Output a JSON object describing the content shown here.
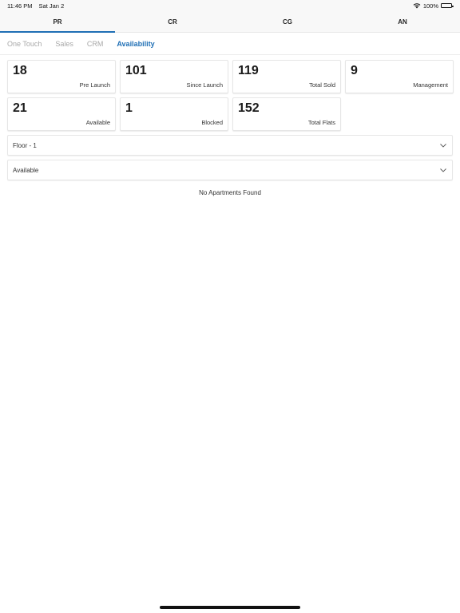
{
  "status_bar": {
    "time": "11:46 PM",
    "date": "Sat Jan 2",
    "battery": "100%"
  },
  "top_tabs": [
    {
      "label": "PR",
      "active": true
    },
    {
      "label": "CR",
      "active": false
    },
    {
      "label": "CG",
      "active": false
    },
    {
      "label": "AN",
      "active": false
    }
  ],
  "sub_tabs": [
    {
      "label": "One Touch",
      "active": false
    },
    {
      "label": "Sales",
      "active": false
    },
    {
      "label": "CRM",
      "active": false
    },
    {
      "label": "Availability",
      "active": true
    }
  ],
  "cards": [
    {
      "value": "18",
      "label": "Pre Launch"
    },
    {
      "value": "101",
      "label": "Since Launch"
    },
    {
      "value": "119",
      "label": "Total Sold"
    },
    {
      "value": "9",
      "label": "Management"
    },
    {
      "value": "21",
      "label": "Available"
    },
    {
      "value": "1",
      "label": "Blocked"
    },
    {
      "value": "152",
      "label": "Total Flats"
    }
  ],
  "filters": {
    "floor": "Floor - 1",
    "status": "Available"
  },
  "empty_message": "No Apartments Found",
  "colors": {
    "accent": "#1f6fb5",
    "inactive_tab": "#a8a8a8"
  },
  "icons": {
    "wifi": "wifi-icon",
    "battery": "battery-icon",
    "dropdown": "chevron-down-icon"
  }
}
